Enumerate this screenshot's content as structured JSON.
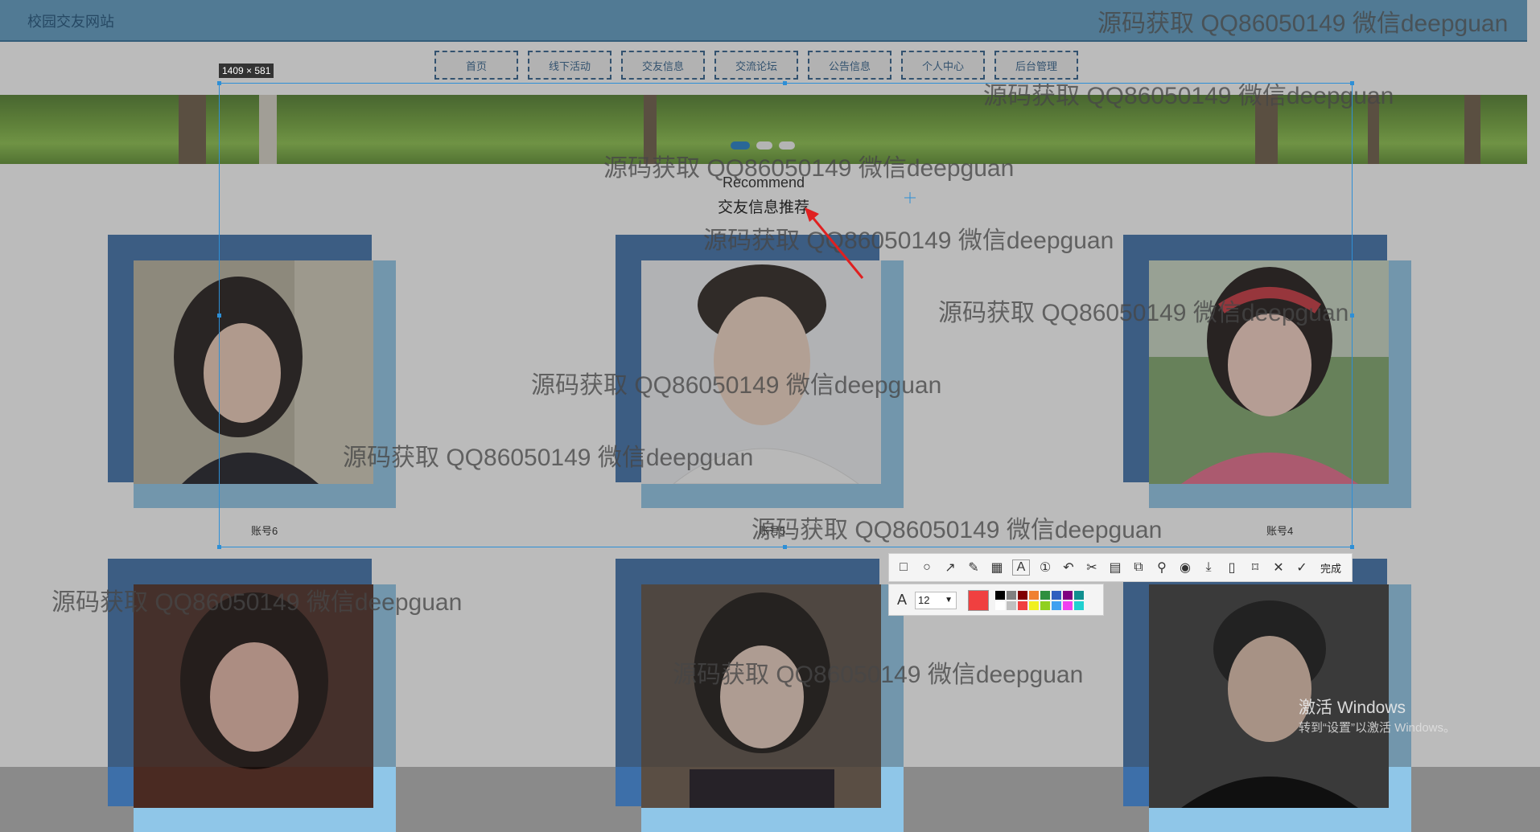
{
  "site": {
    "title": "校园交友网站"
  },
  "nav": [
    "首页",
    "线下活动",
    "交友信息",
    "交流论坛",
    "公告信息",
    "个人中心",
    "后台管理"
  ],
  "section": {
    "en": "Recommend",
    "cn": "交友信息推荐"
  },
  "cards_row1": [
    {
      "name": "账号6",
      "photo": "portrait-woman-1"
    },
    {
      "name": "账号5",
      "photo": "portrait-man-1"
    },
    {
      "name": "账号4",
      "photo": "portrait-woman-2"
    }
  ],
  "cards_row2": [
    {
      "photo": "portrait-woman-3"
    },
    {
      "photo": "portrait-woman-4"
    },
    {
      "photo": "portrait-man-2"
    }
  ],
  "carousel": {
    "count": 3,
    "active_index": 0
  },
  "screenshot_tool": {
    "size_label": "1409 × 581",
    "tools": [
      "rectangle-icon",
      "ellipse-icon",
      "arrow-icon",
      "pencil-icon",
      "mosaic-icon",
      "text-icon",
      "number-icon",
      "undo-icon",
      "scissors-icon",
      "ocr-icon",
      "translate-icon",
      "pin-icon",
      "record-icon",
      "download-icon",
      "save-icon",
      "bookmark-icon",
      "close-icon",
      "check-icon"
    ],
    "done_label": "完成",
    "font_size": "12",
    "current_color": "#f04040",
    "palette": [
      "#000000",
      "#808080",
      "#800000",
      "#f08030",
      "#2f8f3f",
      "#2f5fbf",
      "#800080",
      "#108f8f",
      "#ffffff",
      "#c0c0c0",
      "#f04040",
      "#f0f020",
      "#90d020",
      "#40a0f0",
      "#f040f0",
      "#20d0d0"
    ]
  },
  "watermark_text": "源码获取 QQ86050149 微信deepguan",
  "windows_activation": {
    "line1": "激活 Windows",
    "line2": "转到“设置”以激活 Windows。"
  },
  "colors": {
    "header": "#5c9cc4",
    "card_back": "#3d6fa9",
    "card_accent": "#8fc6e8",
    "selection": "#2e8fd6"
  }
}
